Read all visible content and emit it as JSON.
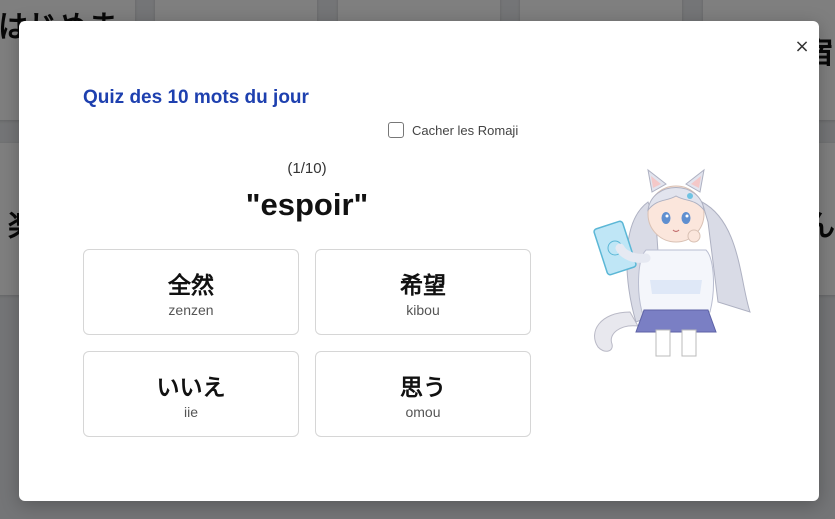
{
  "background_cards": [
    {
      "text": "はじめま"
    },
    {
      "text": ""
    },
    {
      "text": ""
    },
    {
      "text": ""
    },
    {
      "text": "宿"
    },
    {
      "text": "楽"
    },
    {
      "text": "ん"
    }
  ],
  "modal": {
    "close_label": "×",
    "title": "Quiz des 10 mots du jour",
    "hide_romaji_label": "Cacher les Romaji",
    "hide_romaji_checked": false,
    "progress": "(1/10)",
    "question": "\"espoir\"",
    "answers": [
      {
        "kanji": "全然",
        "romaji": "zenzen"
      },
      {
        "kanji": "希望",
        "romaji": "kibou"
      },
      {
        "kanji": "いいえ",
        "romaji": "iie"
      },
      {
        "kanji": "思う",
        "romaji": "omou"
      }
    ],
    "mascot_icon": "catgirl-mascot-icon"
  },
  "colors": {
    "title": "#1e40af",
    "overlay": "rgba(0,0,0,0.5)",
    "card_border": "#d6d6d6"
  }
}
